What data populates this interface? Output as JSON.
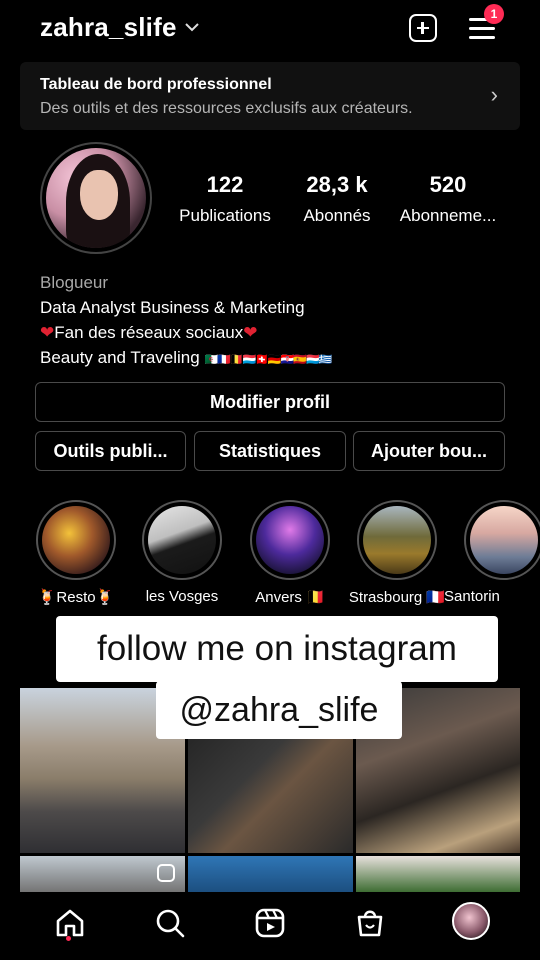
{
  "header": {
    "username": "zahra_slife",
    "chevron_icon": "chevron-down-icon",
    "create_icon": "plus-square-icon",
    "menu_icon": "hamburger-menu-icon",
    "notification_count": "1"
  },
  "pro_dashboard": {
    "title": "Tableau de bord professionnel",
    "subtitle": "Des outils et des ressources exclusifs aux créateurs.",
    "arrow": "›"
  },
  "stats": [
    {
      "value": "122",
      "label": "Publications"
    },
    {
      "value": "28,3 k",
      "label": "Abonnés"
    },
    {
      "value": "520",
      "label": "Abonneme..."
    }
  ],
  "bio": {
    "category": "Blogueur",
    "line1": "Data Analyst Business & Marketing",
    "line2_text": "Fan des réseaux sociaux",
    "line3_text": "Beauty and Traveling",
    "flags": "🇩🇿🇫🇷🇧🇪🇱🇺🇨🇭🇩🇪🇭🇷🇪🇸🇱🇺🇬🇷"
  },
  "buttons": {
    "edit_profile": "Modifier profil",
    "tools": "Outils publi...",
    "stats": "Statistiques",
    "add_button": "Ajouter bou..."
  },
  "highlights": [
    {
      "label": "🍹Resto🍹"
    },
    {
      "label": "les Vosges"
    },
    {
      "label": "Anvers 🇧🇪"
    },
    {
      "label": "Strasbourg 🇫🇷"
    },
    {
      "label": "Santorin"
    }
  ],
  "overlay": {
    "line1": "follow me on instagram",
    "line2": "@zahra_slife"
  },
  "nav": {
    "home": "home-icon",
    "search": "search-icon",
    "reels": "reels-icon",
    "shop": "shop-icon",
    "profile": "profile-avatar-icon"
  },
  "colors": {
    "background": "#000000",
    "notification_badge": "#ff2b55",
    "heart": "#e02232",
    "secondary_text": "#a8a8a8"
  }
}
